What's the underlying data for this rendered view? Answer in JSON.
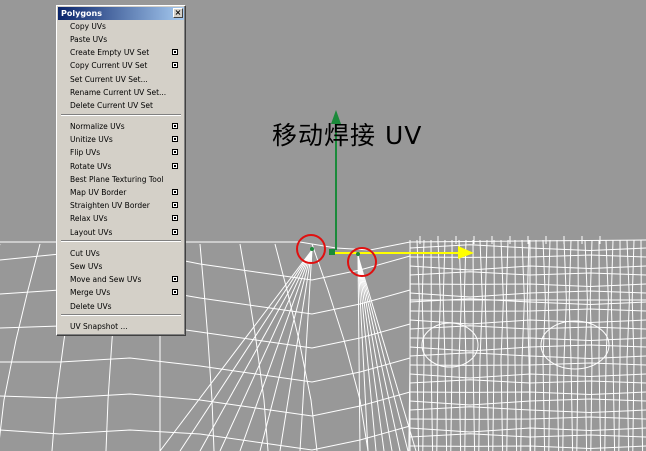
{
  "menu": {
    "title": "Polygons",
    "close_glyph": "×",
    "items": [
      {
        "label": "Copy UVs",
        "option": false
      },
      {
        "label": "Paste UVs",
        "option": false
      },
      {
        "label": "Create Empty UV Set",
        "option": true
      },
      {
        "label": "Copy Current UV Set",
        "option": true
      },
      {
        "label": "Set Current UV Set...",
        "option": false
      },
      {
        "label": "Rename Current UV Set...",
        "option": false
      },
      {
        "label": "Delete Current UV Set",
        "option": false
      },
      {
        "label": "Normalize UVs",
        "option": true
      },
      {
        "label": "Unitize UVs",
        "option": true
      },
      {
        "label": "Flip UVs",
        "option": true
      },
      {
        "label": "Rotate UVs",
        "option": true
      },
      {
        "label": "Best Plane Texturing Tool",
        "option": false
      },
      {
        "label": "Map UV Border",
        "option": true
      },
      {
        "label": "Straighten UV Border",
        "option": true
      },
      {
        "label": "Relax UVs",
        "option": true
      },
      {
        "label": "Layout UVs",
        "option": true
      },
      {
        "label": "Cut UVs",
        "option": false
      },
      {
        "label": "Sew UVs",
        "option": false
      },
      {
        "label": "Move and Sew UVs",
        "option": true
      },
      {
        "label": "Merge UVs",
        "option": true
      },
      {
        "label": "Delete UVs",
        "option": false
      },
      {
        "label": "UV Snapshot ...",
        "option": false
      }
    ]
  },
  "caption": "移动焊接 UV",
  "colors": {
    "viewport_bg": "#989898",
    "mesh_lines": "#ffffff",
    "axis_y": "#1a8a3a",
    "axis_x": "#ffff00",
    "highlight_circle": "#e01010"
  }
}
